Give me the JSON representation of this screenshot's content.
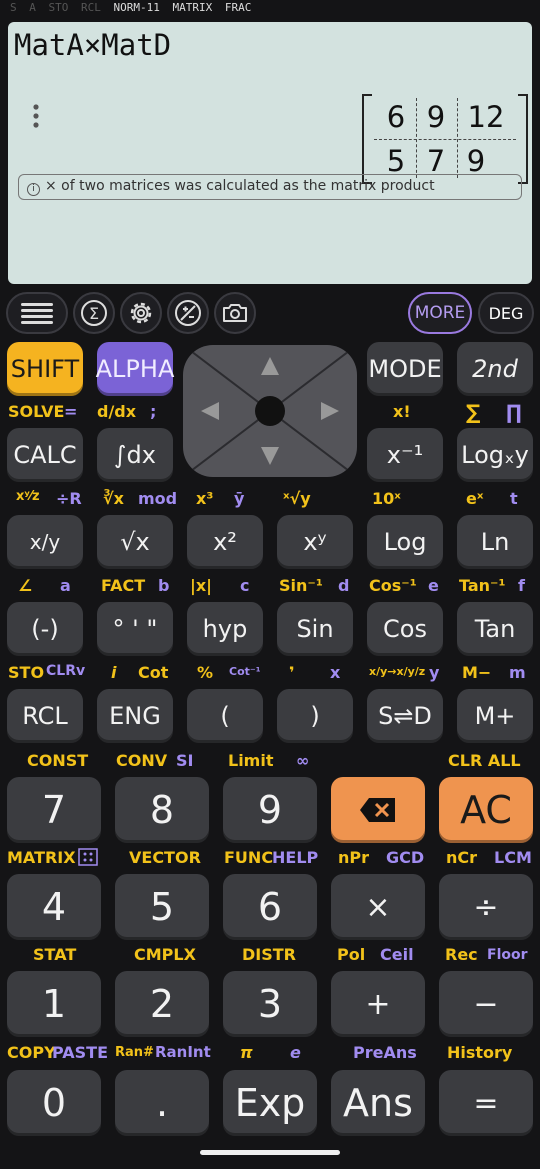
{
  "status": [
    "S",
    "A",
    "STO",
    "RCL",
    "NORM-11",
    "MATRIX",
    "FRAC"
  ],
  "display": {
    "expression": "MatA×MatD",
    "menu_icon": "vertical-dots-icon",
    "matrix": [
      [
        "6",
        "9",
        "12"
      ],
      [
        "5",
        "7",
        "9"
      ]
    ],
    "info": "× of two matrices was calculated as the matrix product"
  },
  "toolbar": {
    "menu_icon": "hamburger-icon",
    "sum_icon": "sigma-icon",
    "settings_icon": "gear-icon",
    "plusminus_icon": "plus-minus-icon",
    "camera_icon": "camera-icon",
    "more": "MORE",
    "deg": "DEG"
  },
  "keys": {
    "shift": "SHIFT",
    "alpha": "ALPHA",
    "mode": "MODE",
    "second": "2nd",
    "calc": "CALC",
    "integral": "∫dx",
    "inverse": "x⁻¹",
    "logxy": "Logₓy",
    "frac": "x/y",
    "sqrt": "√x",
    "square": "x²",
    "power": "xʸ",
    "log": "Log",
    "ln": "Ln",
    "neg": "(-)",
    "dms": "° ' \"",
    "hyp": "hyp",
    "sin": "Sin",
    "cos": "Cos",
    "tan": "Tan",
    "rcl": "RCL",
    "eng": "ENG",
    "lparen": "(",
    "rparen": ")",
    "sd": "S⇌D",
    "mplus": "M+",
    "n7": "7",
    "n8": "8",
    "n9": "9",
    "del_icon": "backspace-icon",
    "ac": "AC",
    "n4": "4",
    "n5": "5",
    "n6": "6",
    "mul": "×",
    "div": "÷",
    "n1": "1",
    "n2": "2",
    "n3": "3",
    "add": "+",
    "sub": "−",
    "n0": "0",
    "dot": ".",
    "exp": "Exp",
    "ans": "Ans",
    "eq": "="
  },
  "labels": {
    "solve": "SOLVE",
    "solve_eq": "=",
    "ddx": "d/dx",
    "semicolon": ";",
    "xfact": "x!",
    "sigma": "∑",
    "pi_cap": "∏",
    "xyz": "xʸ⁄z",
    "divR": "÷R",
    "cbrt": "∛x",
    "mod": "mod",
    "cube": "x³",
    "ybar": "ȳ",
    "xroot": "ˣ√y",
    "tenx": "10ˣ",
    "ex": "eˣ",
    "t": "t",
    "angle": "∠",
    "a": "a",
    "fact": "FACT",
    "b": "b",
    "abs": "|x|",
    "c": "c",
    "asin": "Sin⁻¹",
    "d": "d",
    "acos": "Cos⁻¹",
    "e": "e",
    "atan": "Tan⁻¹",
    "f": "f",
    "sto": "STO",
    "clrv": "CLRv",
    "i": "i",
    "cot": "Cot",
    "pct": "%",
    "acot": "Cot⁻¹",
    "comma": "❜",
    "x": "x",
    "fracconv": "x/y→x/y/z",
    "y": "y",
    "mminus": "M−",
    "m": "m",
    "const": "CONST",
    "conv": "CONV",
    "si": "SI",
    "limit": "Limit",
    "inf": "∞",
    "clrall": "CLR ALL",
    "matrix": "MATRIX",
    "matrix_icon": "matrix-grid-icon",
    "vector": "VECTOR",
    "func": "FUNC",
    "help": "HELP",
    "npr": "nPr",
    "gcd": "GCD",
    "ncr": "nCr",
    "lcm": "LCM",
    "stat": "STAT",
    "cmplx": "CMPLX",
    "distr": "DISTR",
    "pol": "Pol",
    "ceil": "Ceil",
    "rec": "Rec",
    "floor": "Floor",
    "copy": "COPY",
    "paste": "PASTE",
    "ran": "Ran#",
    "ranint": "RanInt",
    "pi": "π",
    "econst": "e",
    "preans": "PreAns",
    "history": "History"
  }
}
